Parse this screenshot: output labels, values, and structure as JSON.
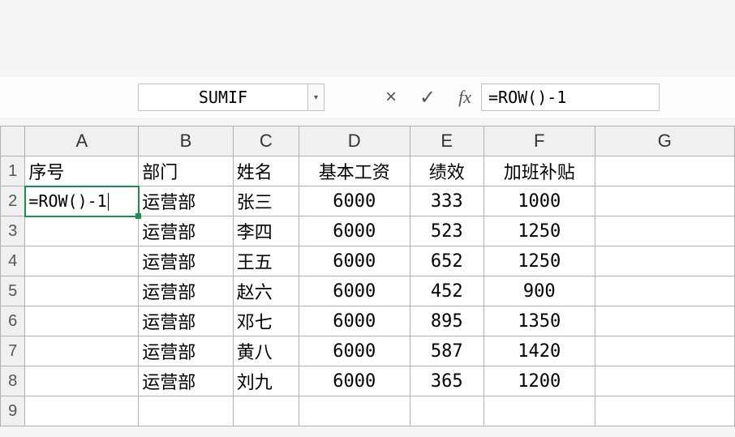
{
  "formula_bar": {
    "name_box": "SUMIF",
    "cancel_icon": "×",
    "enter_icon": "✓",
    "fx_label": "fx",
    "formula": "=ROW()-1"
  },
  "columns": [
    "",
    "A",
    "B",
    "C",
    "D",
    "E",
    "F",
    "G"
  ],
  "row_numbers": [
    "1",
    "2",
    "3",
    "4",
    "5",
    "6",
    "7",
    "8",
    "9"
  ],
  "header_row": {
    "A": "序号",
    "B": "部门",
    "C": "姓名",
    "D": "基本工资",
    "E": "绩效",
    "F": "加班补贴"
  },
  "active_cell_content": "=ROW()-1",
  "chart_data": {
    "type": "table",
    "columns": [
      "序号",
      "部门",
      "姓名",
      "基本工资",
      "绩效",
      "加班补贴"
    ],
    "rows": [
      {
        "部门": "运营部",
        "姓名": "张三",
        "基本工资": 6000,
        "绩效": 333,
        "加班补贴": 1000
      },
      {
        "部门": "运营部",
        "姓名": "李四",
        "基本工资": 6000,
        "绩效": 523,
        "加班补贴": 1250
      },
      {
        "部门": "运营部",
        "姓名": "王五",
        "基本工资": 6000,
        "绩效": 652,
        "加班补贴": 1250
      },
      {
        "部门": "运营部",
        "姓名": "赵六",
        "基本工资": 6000,
        "绩效": 452,
        "加班补贴": 900
      },
      {
        "部门": "运营部",
        "姓名": "邓七",
        "基本工资": 6000,
        "绩效": 895,
        "加班补贴": 1350
      },
      {
        "部门": "运营部",
        "姓名": "黄八",
        "基本工资": 6000,
        "绩效": 587,
        "加班补贴": 1420
      },
      {
        "部门": "运营部",
        "姓名": "刘九",
        "基本工资": 6000,
        "绩效": 365,
        "加班补贴": 1200
      }
    ]
  }
}
